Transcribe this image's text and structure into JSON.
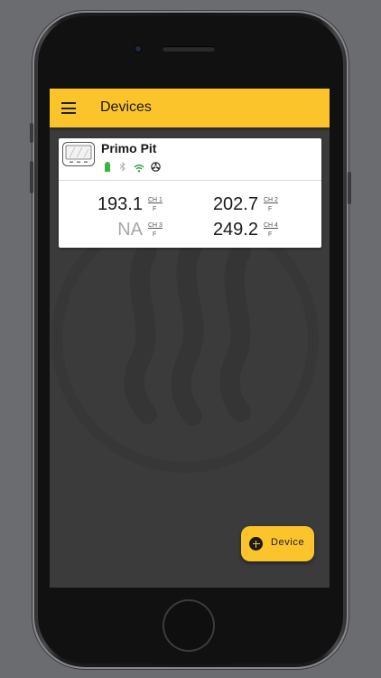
{
  "appbar": {
    "title": "Devices"
  },
  "device": {
    "name": "Primo Pit",
    "status_icons": [
      "battery-icon",
      "bluetooth-icon",
      "wifi-icon",
      "fan-icon"
    ],
    "readings": [
      {
        "value": "193.1",
        "channel": "CH 1",
        "unit": "F",
        "available": true
      },
      {
        "value": "202.7",
        "channel": "CH 2",
        "unit": "F",
        "available": true
      },
      {
        "value": "NA",
        "channel": "CH 3",
        "unit": "F",
        "available": false
      },
      {
        "value": "249.2",
        "channel": "CH 4",
        "unit": "F",
        "available": true
      }
    ]
  },
  "fab": {
    "label": "Device"
  },
  "colors": {
    "accent": "#fcc42b",
    "battery": "#3cb43c",
    "wifi": "#2f9e44",
    "screen_bg": "#3b3b3b"
  }
}
